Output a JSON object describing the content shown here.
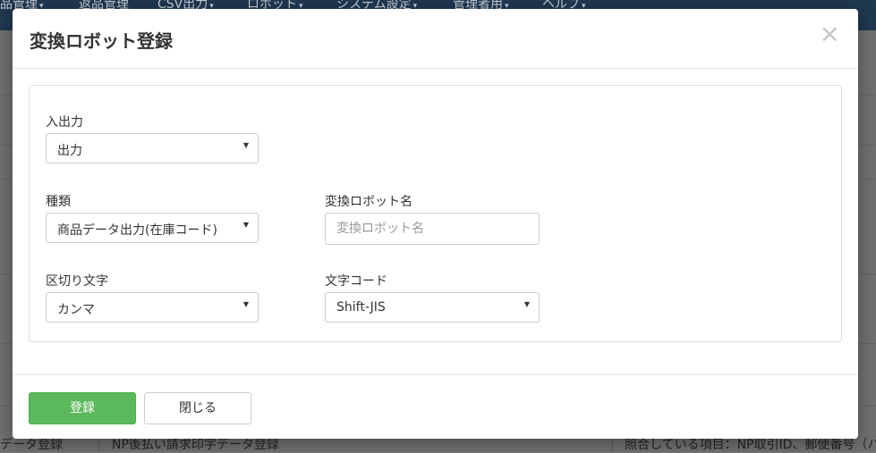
{
  "background": {
    "nav_items": [
      {
        "label": "品管理",
        "caret": "▾"
      },
      {
        "label": "返品管理",
        "caret": ""
      },
      {
        "label": "CSV出力",
        "caret": "▾"
      },
      {
        "label": "ロボット",
        "caret": "▾"
      },
      {
        "label": "システム設定",
        "caret": "▾"
      },
      {
        "label": "管理者用",
        "caret": "▾"
      },
      {
        "label": "ヘルプ",
        "caret": "▾"
      }
    ],
    "bottom_row": {
      "col1": "データ登録",
      "col2": "NP後払い請求印字データ登録",
      "col3": "照合している項目：NP取引ID、郵便番号（ハ"
    }
  },
  "modal": {
    "title": "変換ロボット登録",
    "close_icon": "×",
    "io_label": "入出力",
    "io_value": "出力",
    "type_label": "種類",
    "type_value": "商品データ出力(在庫コード)",
    "robot_name_label": "変換ロボット名",
    "robot_name_value": "",
    "robot_name_placeholder": "変換ロボット名",
    "delimiter_label": "区切り文字",
    "delimiter_value": "カンマ",
    "charset_label": "文字コード",
    "charset_value": "Shift-JIS",
    "dropdown_arrow": "▼",
    "submit_label": "登録",
    "close_label": "閉じる"
  },
  "colors": {
    "primary_button": "#5cb85c",
    "nav_background": "#1f3850"
  }
}
